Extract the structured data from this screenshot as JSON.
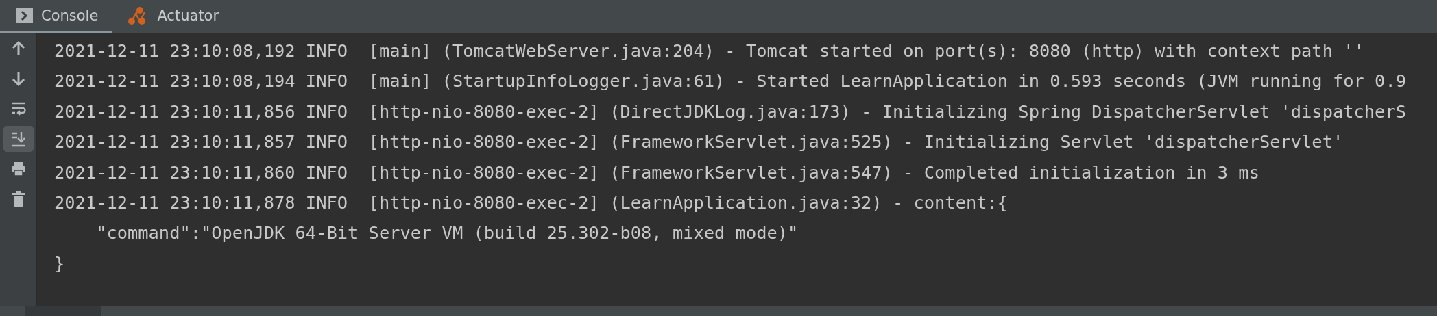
{
  "tabs": [
    {
      "label": "Console",
      "selected": true
    },
    {
      "label": "Actuator",
      "selected": false
    }
  ],
  "toolbar": [
    {
      "selected": false
    },
    {
      "selected": false
    },
    {
      "selected": false
    },
    {
      "selected": true
    },
    {
      "selected": false
    },
    {
      "selected": false
    }
  ],
  "console_lines": [
    "2021-12-11 23:10:08,192 INFO  [main] (TomcatWebServer.java:204) - Tomcat started on port(s): 8080 (http) with context path ''",
    "2021-12-11 23:10:08,194 INFO  [main] (StartupInfoLogger.java:61) - Started LearnApplication in 0.593 seconds (JVM running for 0.9",
    "2021-12-11 23:10:11,856 INFO  [http-nio-8080-exec-2] (DirectJDKLog.java:173) - Initializing Spring DispatcherServlet 'dispatcherS",
    "2021-12-11 23:10:11,857 INFO  [http-nio-8080-exec-2] (FrameworkServlet.java:525) - Initializing Servlet 'dispatcherServlet'",
    "2021-12-11 23:10:11,860 INFO  [http-nio-8080-exec-2] (FrameworkServlet.java:547) - Completed initialization in 3 ms",
    "2021-12-11 23:10:11,878 INFO  [http-nio-8080-exec-2] (LearnApplication.java:32) - content:{",
    "    \"command\":\"OpenJDK 64-Bit Server VM (build 25.302-b08, mixed mode)\"",
    "}"
  ]
}
